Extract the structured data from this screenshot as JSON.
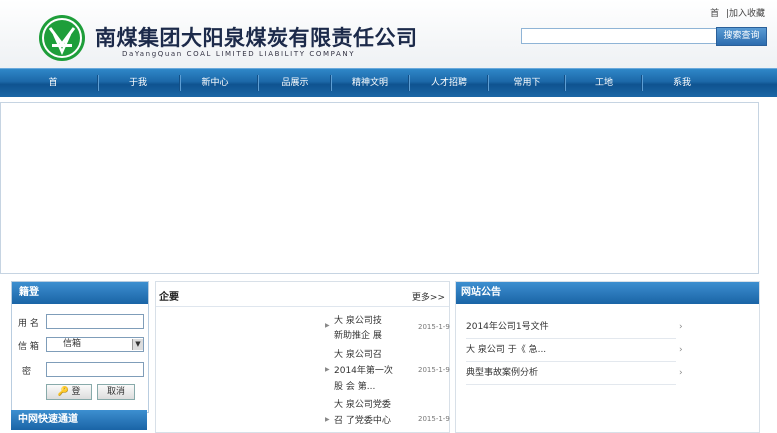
{
  "header": {
    "company_name": "南煤集团大阳泉煤炭有限责任公司",
    "company_name_en": "DaYangQuan COAL LIMITED LIABILITY COMPANY",
    "top_links": [
      "首",
      "|加入收藏"
    ],
    "search_placeholder": "",
    "search_button": "搜索查询"
  },
  "nav": {
    "items": [
      "首",
      "于我",
      "新中心",
      "品展示",
      "精神文明",
      "人才招聘",
      "常用下",
      "工地",
      "系我"
    ]
  },
  "login": {
    "title": "籍登",
    "username_label": "用 名",
    "mailbox_label": "信 箱",
    "mailbox_value": "信箱",
    "password_label": "密",
    "login_button": "登",
    "cancel_button": "取消"
  },
  "quick_channel": {
    "title": "中网快速通道"
  },
  "news": {
    "title": "企要",
    "more": "更多>>",
    "items": [
      {
        "line1": "大 泉公司技",
        "line2": "新助推企  展",
        "date": "2015-1-9"
      },
      {
        "line1": "大 泉公司召",
        "line2": "2014年第一次",
        "line3": "股 会 第...",
        "date": "2015-1-9"
      },
      {
        "line1": "大 泉公司党委",
        "line2": "召 了党委中心",
        "date": "2015-1-9"
      }
    ]
  },
  "notice": {
    "title": "网站公告",
    "items": [
      "2014年公司1号文件",
      "大 泉公司 于《  急...",
      "典型事故案例分析"
    ]
  },
  "colors": {
    "nav_blue": "#1c68a8",
    "header_title": "#1c2a4a",
    "logo_green": "#1e9e3a"
  }
}
